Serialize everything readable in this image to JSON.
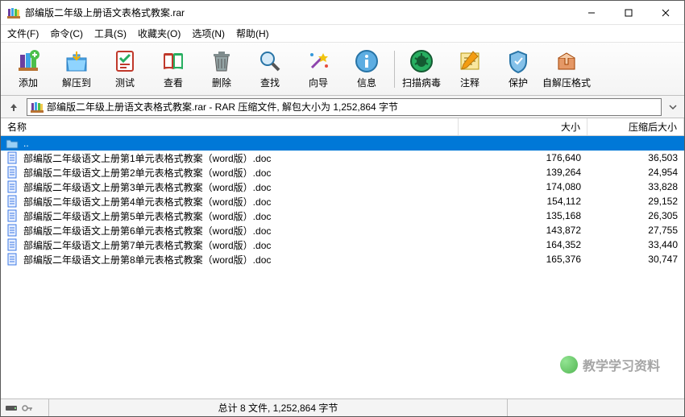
{
  "window": {
    "title": "部编版二年级上册语文表格式教案.rar"
  },
  "menu": {
    "file": "文件(F)",
    "commands": "命令(C)",
    "tools": "工具(S)",
    "favorites": "收藏夹(O)",
    "options": "选项(N)",
    "help": "帮助(H)"
  },
  "toolbar": {
    "add": "添加",
    "extract_to": "解压到",
    "test": "测试",
    "view": "查看",
    "delete": "删除",
    "find": "查找",
    "wizard": "向导",
    "info": "信息",
    "virus_scan": "扫描病毒",
    "comment": "注释",
    "protect": "保护",
    "sfx": "自解压格式"
  },
  "path": {
    "text": "部编版二年级上册语文表格式教案.rar - RAR 压缩文件, 解包大小为 1,252,864 字节"
  },
  "columns": {
    "name": "名称",
    "size": "大小",
    "packed": "压缩后大小"
  },
  "updir": "..",
  "files": [
    {
      "name": "部编版二年级语文上册第1单元表格式教案（word版）.doc",
      "size": "176,640",
      "packed": "36,503"
    },
    {
      "name": "部编版二年级语文上册第2单元表格式教案（word版）.doc",
      "size": "139,264",
      "packed": "24,954"
    },
    {
      "name": "部编版二年级语文上册第3单元表格式教案（word版）.doc",
      "size": "174,080",
      "packed": "33,828"
    },
    {
      "name": "部编版二年级语文上册第4单元表格式教案（word版）.doc",
      "size": "154,112",
      "packed": "29,152"
    },
    {
      "name": "部编版二年级语文上册第5单元表格式教案（word版）.doc",
      "size": "135,168",
      "packed": "26,305"
    },
    {
      "name": "部编版二年级语文上册第6单元表格式教案（word版）.doc",
      "size": "143,872",
      "packed": "27,755"
    },
    {
      "name": "部编版二年级语文上册第7单元表格式教案（word版）.doc",
      "size": "164,352",
      "packed": "33,440"
    },
    {
      "name": "部编版二年级语文上册第8单元表格式教案（word版）.doc",
      "size": "165,376",
      "packed": "30,747"
    }
  ],
  "status": {
    "summary": "总计 8 文件, 1,252,864 字节"
  },
  "watermark": "教学学习资料"
}
